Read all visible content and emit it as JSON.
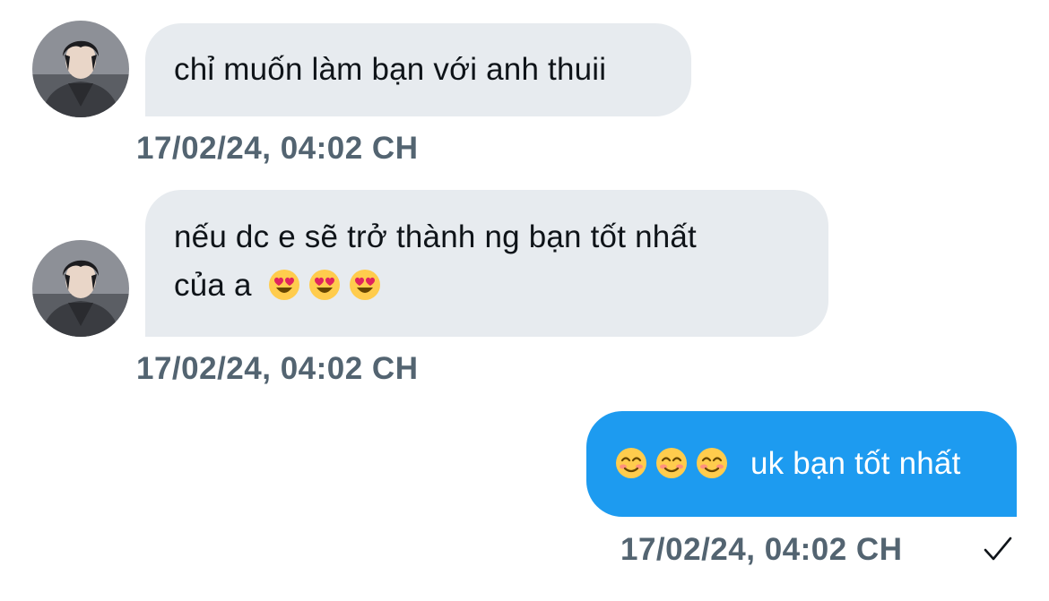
{
  "conversation": {
    "messages": [
      {
        "direction": "incoming",
        "text_lines": [
          "chỉ muốn làm bạn với anh thuii"
        ],
        "timestamp": "17/02/24, 04:02 CH"
      },
      {
        "direction": "incoming",
        "text_lines": [
          "nếu dc e sẽ trở thành ng bạn tốt nhất",
          "của a"
        ],
        "emojis": [
          "heart-eyes-emoji",
          "heart-eyes-emoji",
          "heart-eyes-emoji"
        ],
        "timestamp": "17/02/24, 04:02 CH"
      },
      {
        "direction": "outgoing",
        "emojis": [
          "smiling-emoji",
          "smiling-emoji",
          "smiling-emoji"
        ],
        "text": "uk bạn tốt nhất",
        "timestamp": "17/02/24, 04:02 CH",
        "status_icon": "checkmark-icon"
      }
    ]
  },
  "colors": {
    "incoming_bubble": "#e7ebef",
    "outgoing_bubble": "#1d9bf0",
    "timestamp": "#536471",
    "text": "#0f1419"
  }
}
